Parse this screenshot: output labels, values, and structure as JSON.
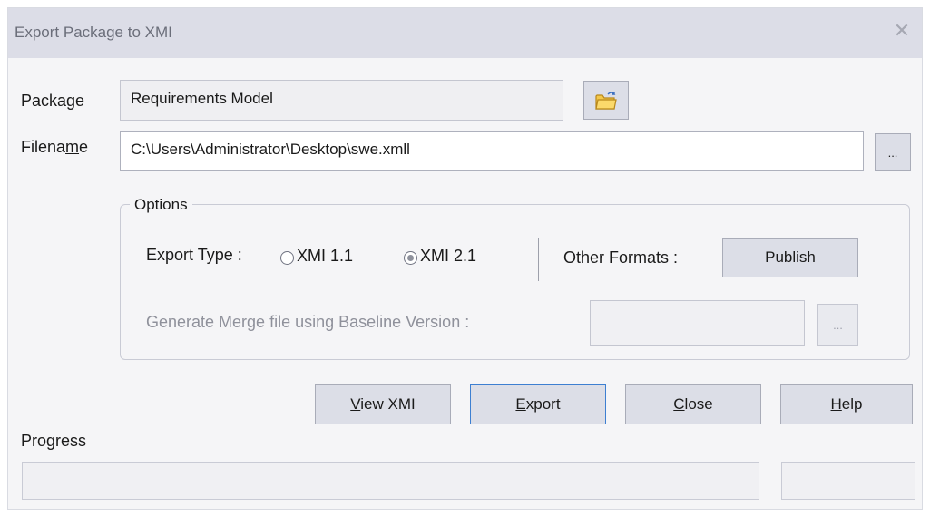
{
  "window": {
    "title": "Export Package to XMI",
    "close_glyph": "✕"
  },
  "package": {
    "label": "Package",
    "value": "Requirements Model",
    "browse_icon": "folder-icon"
  },
  "filename": {
    "label_pre": "Filena",
    "label_accel": "m",
    "label_post": "e",
    "value": "C:\\Users\\Administrator\\Desktop\\swe.xmll",
    "browse_label": "..."
  },
  "options": {
    "legend": "Options",
    "export_type_label": "Export Type :",
    "xmi11_label": "XMI 1.1",
    "xmi21_label": "XMI 2.1",
    "selected": "XMI 2.1",
    "other_formats_label": "Other Formats :",
    "publish_label": "Publish",
    "merge_label": "Generate Merge file using Baseline Version :",
    "merge_value": "",
    "merge_browse_label": "..."
  },
  "buttons": {
    "view_xmi": {
      "accel": "V",
      "rest": "iew XMI"
    },
    "export": {
      "accel": "E",
      "rest": "xport"
    },
    "close": {
      "accel": "C",
      "rest": "lose"
    },
    "help": {
      "accel": "H",
      "rest": "elp"
    }
  },
  "progress": {
    "label": "Progress",
    "value": 0
  }
}
